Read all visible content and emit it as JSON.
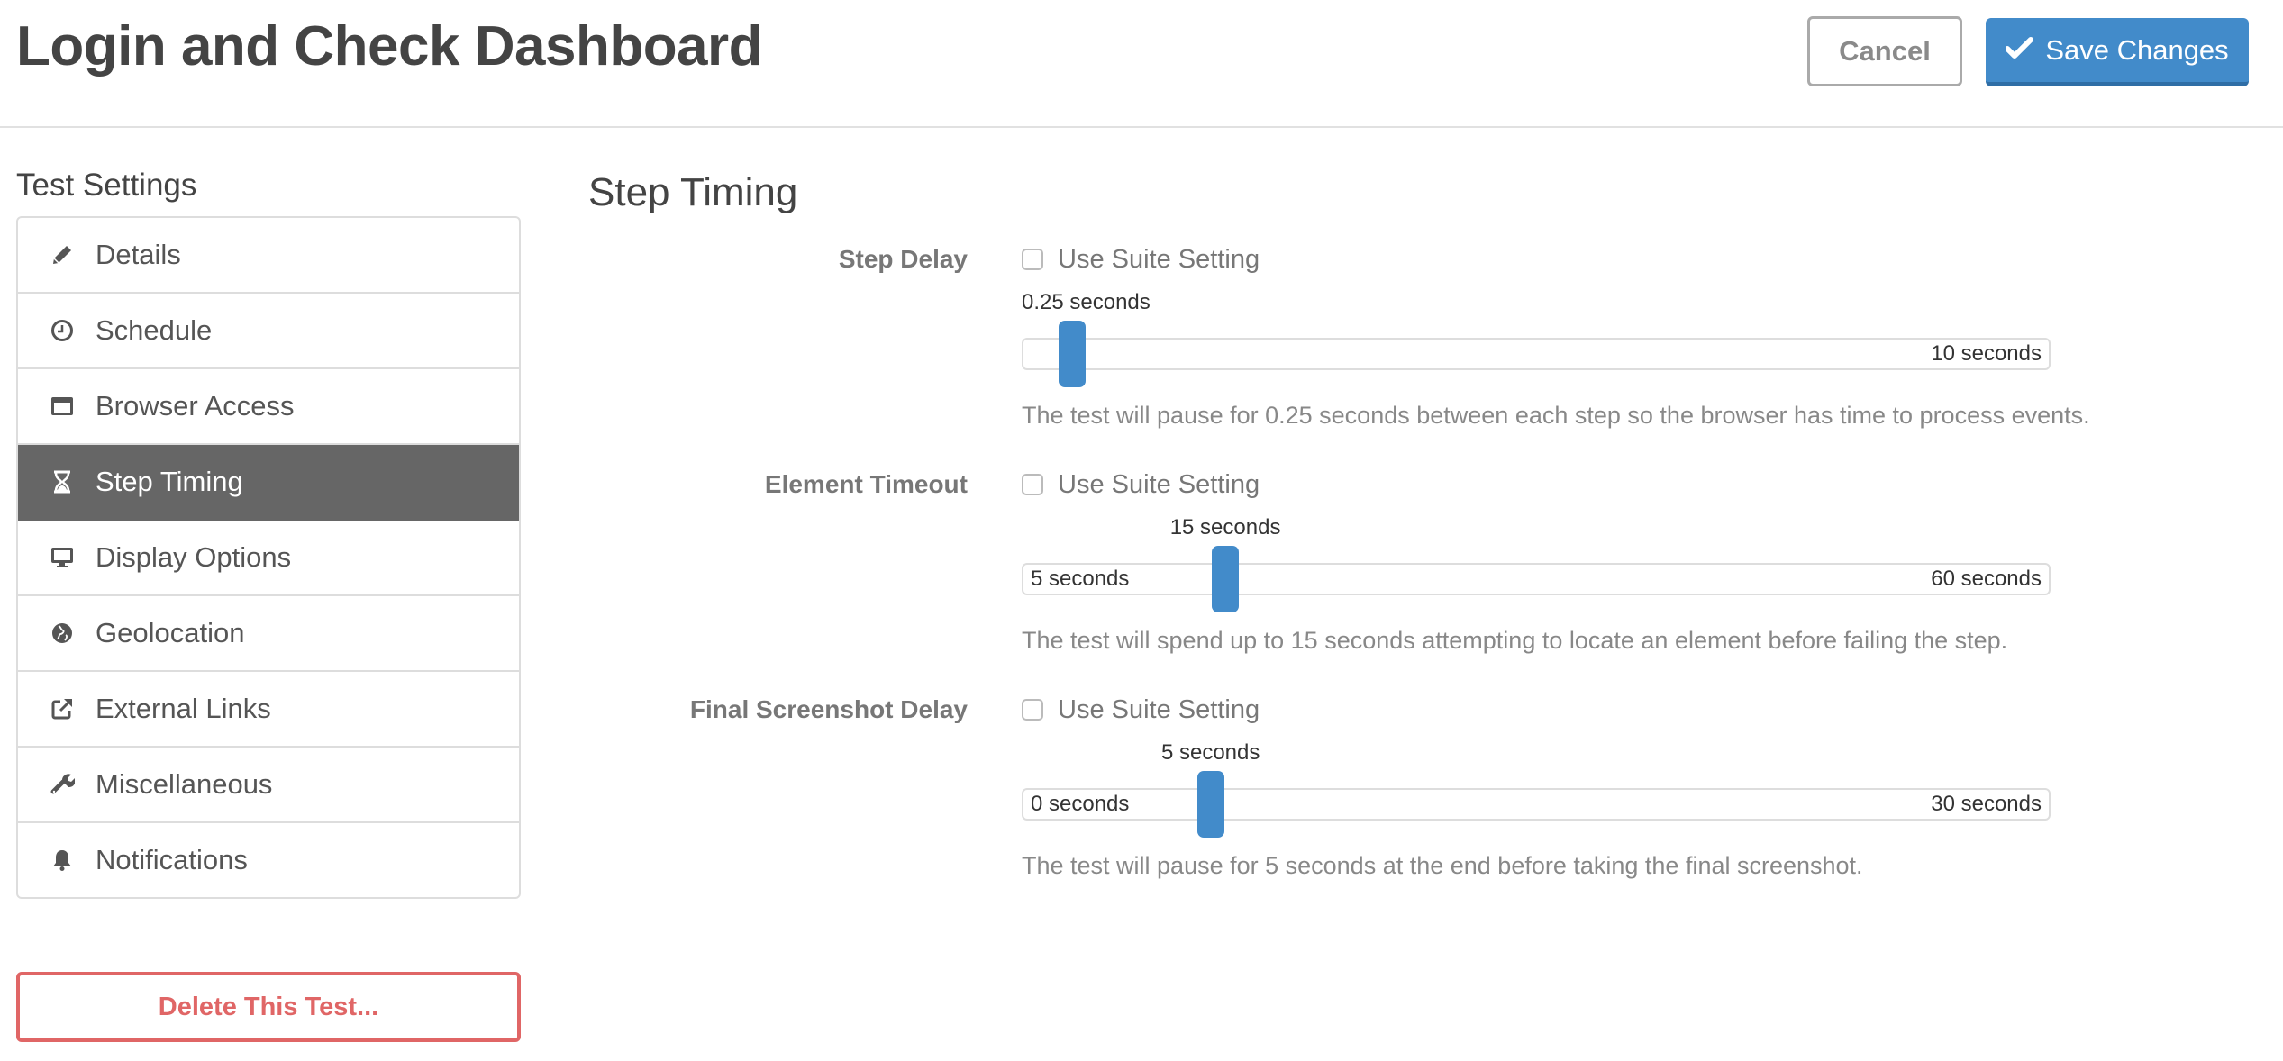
{
  "header": {
    "title": "Login and Check Dashboard",
    "cancel_label": "Cancel",
    "save_label": "Save Changes",
    "save_icon": "check-icon"
  },
  "sidebar": {
    "title": "Test Settings",
    "items": [
      {
        "label": "Details",
        "icon": "pencil-icon",
        "active": false
      },
      {
        "label": "Schedule",
        "icon": "clock-icon",
        "active": false
      },
      {
        "label": "Browser Access",
        "icon": "browser-window-icon",
        "active": false
      },
      {
        "label": "Step Timing",
        "icon": "hourglass-icon",
        "active": true
      },
      {
        "label": "Display Options",
        "icon": "monitor-icon",
        "active": false
      },
      {
        "label": "Geolocation",
        "icon": "globe-icon",
        "active": false
      },
      {
        "label": "External Links",
        "icon": "external-link-icon",
        "active": false
      },
      {
        "label": "Miscellaneous",
        "icon": "wrench-icon",
        "active": false
      },
      {
        "label": "Notifications",
        "icon": "bell-icon",
        "active": false
      }
    ],
    "delete_label": "Delete This Test..."
  },
  "main": {
    "title": "Step Timing",
    "settings": [
      {
        "label": "Step Delay",
        "use_suite_label": "Use Suite Setting",
        "use_suite_checked": false,
        "value": 0.25,
        "min": 0,
        "max": 10,
        "value_label": "0.25 seconds",
        "min_label": "",
        "max_label": "10 seconds",
        "help": "The test will pause for 0.25 seconds between each step so the browser has time to process events."
      },
      {
        "label": "Element Timeout",
        "use_suite_label": "Use Suite Setting",
        "use_suite_checked": false,
        "value": 15,
        "min": 5,
        "max": 60,
        "value_label": "15 seconds",
        "min_label": "5 seconds",
        "max_label": "60 seconds",
        "help": "The test will spend up to 15 seconds attempting to locate an element before failing the step."
      },
      {
        "label": "Final Screenshot Delay",
        "use_suite_label": "Use Suite Setting",
        "use_suite_checked": false,
        "value": 5,
        "min": 0,
        "max": 30,
        "value_label": "5 seconds",
        "min_label": "0 seconds",
        "max_label": "30 seconds",
        "help": "The test will pause for 5 seconds at the end before taking the final screenshot."
      }
    ]
  },
  "colors": {
    "accent": "#428bca",
    "danger": "#e06666",
    "active_nav": "#666666"
  }
}
